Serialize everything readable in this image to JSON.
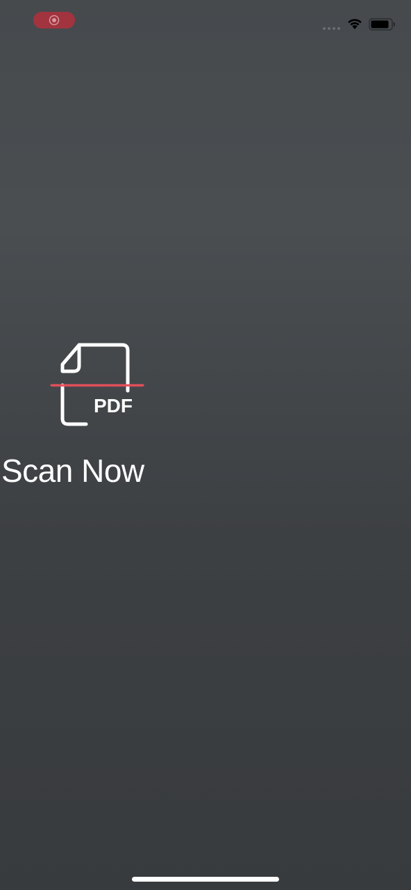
{
  "status_bar": {
    "recording_icon": "record-icon",
    "wifi_icon": "wifi-icon",
    "battery_icon": "battery-icon",
    "signal_icon": "signal-dots-icon"
  },
  "scan": {
    "icon_text": "PDF",
    "icon_name": "pdf-scan-icon",
    "title": "Scan Now"
  },
  "colors": {
    "scan_line": "#e8505b",
    "record_pill": "#b2303d",
    "foreground": "#ffffff"
  }
}
